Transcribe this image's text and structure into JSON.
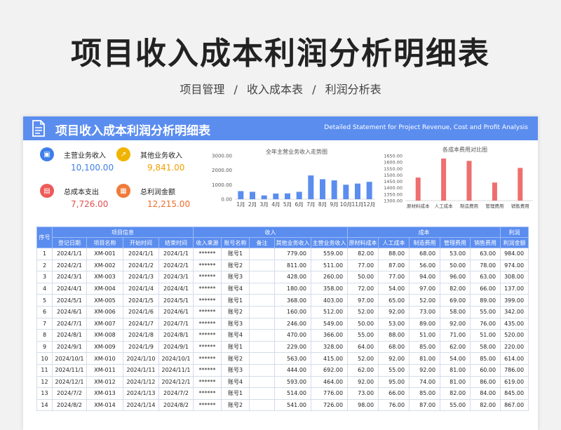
{
  "page": {
    "title": "项目收入成本利润分析明细表",
    "breadcrumb": [
      "项目管理",
      "/",
      "收入成本表",
      "/",
      "利润分析表"
    ]
  },
  "sheet": {
    "banner_title": "项目收入成本利润分析明细表",
    "banner_subtitle": "Detailed Statement for Project Revenue, Cost and Profit Analysis"
  },
  "kpis": [
    {
      "label": "主营业务收入",
      "value": "10,100.00",
      "color": "#3e7ee8",
      "icon": "briefcase-icon"
    },
    {
      "label": "其他业务收入",
      "value": "9,841.00",
      "color": "#f0b400",
      "icon": "trend-up-icon"
    },
    {
      "label": "总成本支出",
      "value": "7,726.00",
      "color": "#ee5a5a",
      "icon": "wallet-icon"
    },
    {
      "label": "总利润金额",
      "value": "12,215.00",
      "color": "#f07a3a",
      "icon": "calculator-icon"
    }
  ],
  "chart_data": [
    {
      "type": "bar",
      "title": "全年主营业务收入走势图",
      "categories": [
        "1月",
        "2月",
        "3月",
        "4月",
        "5月",
        "6月",
        "7月",
        "8月",
        "9月",
        "10月",
        "11月",
        "12月"
      ],
      "values": [
        559,
        511,
        260,
        390,
        403,
        512,
        1640,
        1380,
        1300,
        1000,
        1080,
        1200
      ],
      "ylim": [
        0,
        3000
      ],
      "yticks": [
        "0.00",
        "1000.00",
        "2000.00",
        "3000.00"
      ],
      "color": "#5b8def"
    },
    {
      "type": "bar",
      "title": "各成本费用对比图",
      "categories": [
        "原材料成本",
        "人工成本",
        "制造费用",
        "管理费用",
        "销售费用"
      ],
      "values": [
        1480,
        1628,
        1610,
        1441,
        1555
      ],
      "ylim": [
        1300,
        1650
      ],
      "yticks": [
        "1300.00",
        "1350.00",
        "1400.00",
        "1450.00",
        "1500.00",
        "1550.00",
        "1600.00",
        "1650.00"
      ],
      "color": "#ee6f6f"
    }
  ],
  "table": {
    "groups": [
      {
        "label": "序号",
        "span": 1
      },
      {
        "label": "项目信息",
        "span": 4
      },
      {
        "label": "收入",
        "span": 5
      },
      {
        "label": "成本",
        "span": 5
      },
      {
        "label": "利润",
        "span": 1
      }
    ],
    "headers": [
      "登记日期",
      "项目名称",
      "开始时间",
      "结束时间",
      "收入来源",
      "账号名称",
      "备注",
      "其他业务收入",
      "主营业务收入",
      "原材料成本",
      "人工成本",
      "制造费用",
      "管理费用",
      "销售费用",
      "利润金额"
    ],
    "rows": [
      [
        "1",
        "2024/1/1",
        "XM-001",
        "2024/1/1",
        "2024/1/1",
        "******",
        "账号1",
        "",
        "779.00",
        "559.00",
        "82.00",
        "88.00",
        "68.00",
        "53.00",
        "63.00",
        "984.00"
      ],
      [
        "2",
        "2024/2/1",
        "XM-002",
        "2024/1/2",
        "2024/2/1",
        "******",
        "账号2",
        "",
        "811.00",
        "511.00",
        "77.00",
        "87.00",
        "56.00",
        "50.00",
        "78.00",
        "974.00"
      ],
      [
        "3",
        "2024/3/1",
        "XM-003",
        "2024/1/3",
        "2024/3/1",
        "******",
        "账号3",
        "",
        "428.00",
        "260.00",
        "50.00",
        "77.00",
        "94.00",
        "96.00",
        "63.00",
        "308.00"
      ],
      [
        "4",
        "2024/4/1",
        "XM-004",
        "2024/1/4",
        "2024/4/1",
        "******",
        "账号4",
        "",
        "180.00",
        "358.00",
        "72.00",
        "54.00",
        "97.00",
        "82.00",
        "66.00",
        "137.00"
      ],
      [
        "5",
        "2024/5/1",
        "XM-005",
        "2024/1/5",
        "2024/5/1",
        "******",
        "账号1",
        "",
        "368.00",
        "403.00",
        "97.00",
        "65.00",
        "52.00",
        "69.00",
        "89.00",
        "399.00"
      ],
      [
        "6",
        "2024/6/1",
        "XM-006",
        "2024/1/6",
        "2024/6/1",
        "******",
        "账号2",
        "",
        "160.00",
        "512.00",
        "52.00",
        "92.00",
        "73.00",
        "58.00",
        "55.00",
        "342.00"
      ],
      [
        "7",
        "2024/7/1",
        "XM-007",
        "2024/1/7",
        "2024/7/1",
        "******",
        "账号3",
        "",
        "246.00",
        "549.00",
        "50.00",
        "53.00",
        "89.00",
        "92.00",
        "76.00",
        "435.00"
      ],
      [
        "8",
        "2024/8/1",
        "XM-008",
        "2024/1/8",
        "2024/8/1",
        "******",
        "账号4",
        "",
        "470.00",
        "366.00",
        "55.00",
        "88.00",
        "51.00",
        "71.00",
        "51.00",
        "520.00"
      ],
      [
        "9",
        "2024/9/1",
        "XM-009",
        "2024/1/9",
        "2024/9/1",
        "******",
        "账号1",
        "",
        "229.00",
        "328.00",
        "64.00",
        "68.00",
        "85.00",
        "62.00",
        "58.00",
        "220.00"
      ],
      [
        "10",
        "2024/10/1",
        "XM-010",
        "2024/1/10",
        "2024/10/1",
        "******",
        "账号2",
        "",
        "563.00",
        "415.00",
        "52.00",
        "92.00",
        "81.00",
        "54.00",
        "85.00",
        "614.00"
      ],
      [
        "11",
        "2024/11/1",
        "XM-011",
        "2024/1/11",
        "2024/11/1",
        "******",
        "账号3",
        "",
        "444.00",
        "692.00",
        "62.00",
        "55.00",
        "92.00",
        "81.00",
        "60.00",
        "786.00"
      ],
      [
        "12",
        "2024/12/1",
        "XM-012",
        "2024/1/12",
        "2024/12/1",
        "******",
        "账号4",
        "",
        "593.00",
        "464.00",
        "92.00",
        "95.00",
        "74.00",
        "81.00",
        "86.00",
        "619.00"
      ],
      [
        "13",
        "2024/7/2",
        "XM-013",
        "2024/1/13",
        "2024/7/2",
        "******",
        "账号1",
        "",
        "514.00",
        "776.00",
        "73.00",
        "66.00",
        "85.00",
        "82.00",
        "84.00",
        "845.00"
      ],
      [
        "14",
        "2024/8/2",
        "XM-014",
        "2024/1/14",
        "2024/8/2",
        "******",
        "账号2",
        "",
        "541.00",
        "726.00",
        "98.00",
        "76.00",
        "87.00",
        "55.00",
        "82.00",
        "867.00"
      ]
    ]
  }
}
